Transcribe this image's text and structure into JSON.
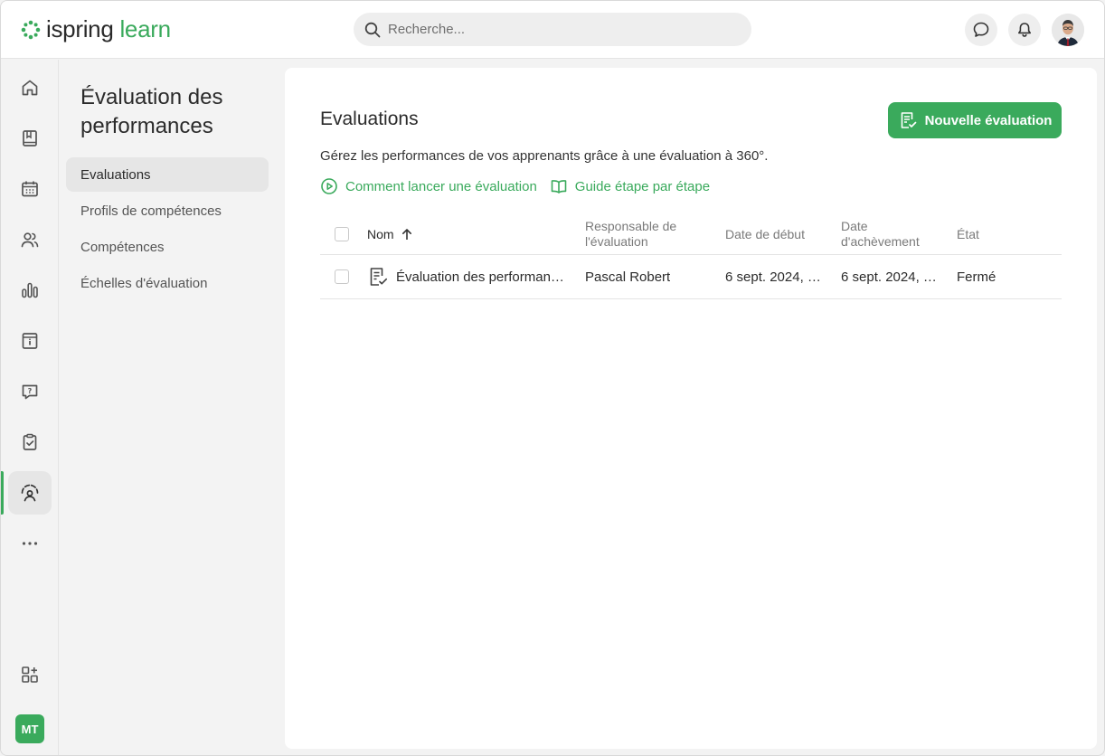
{
  "app": {
    "logo_part1": "ispring",
    "logo_part2": "learn"
  },
  "header": {
    "search_placeholder": "Recherche..."
  },
  "rail": {
    "items": [
      "home-icon",
      "book-icon",
      "calendar-icon",
      "users-icon",
      "chart-icon",
      "info-page-icon",
      "question-icon",
      "clipboard-check-icon",
      "performance-icon",
      "more-icon"
    ],
    "bottom_icon": "apps-add-icon",
    "user_initials": "MT",
    "accent": "#3aaa5c"
  },
  "subnav": {
    "title": "Évaluation des performances",
    "items": [
      {
        "label": "Evaluations",
        "active": true
      },
      {
        "label": "Profils de compétences",
        "active": false
      },
      {
        "label": "Compétences",
        "active": false
      },
      {
        "label": "Échelles d'évaluation",
        "active": false
      }
    ]
  },
  "main": {
    "title": "Evaluations",
    "new_button": "Nouvelle évaluation",
    "description": "Gérez les performances de vos apprenants grâce à une évaluation à 360°.",
    "link_howto": "Comment lancer une évaluation",
    "link_guide": "Guide étape par étape"
  },
  "table": {
    "columns": {
      "name": "Nom",
      "owner": "Responsable de l'évaluation",
      "start": "Date de début",
      "end": "Date d'achèvement",
      "state": "État"
    },
    "rows": [
      {
        "name": "Évaluation des performan…",
        "owner": "Pascal Robert",
        "start": "6 sept. 2024, …",
        "end": "6 sept. 2024, …",
        "state": "Fermé"
      }
    ]
  }
}
